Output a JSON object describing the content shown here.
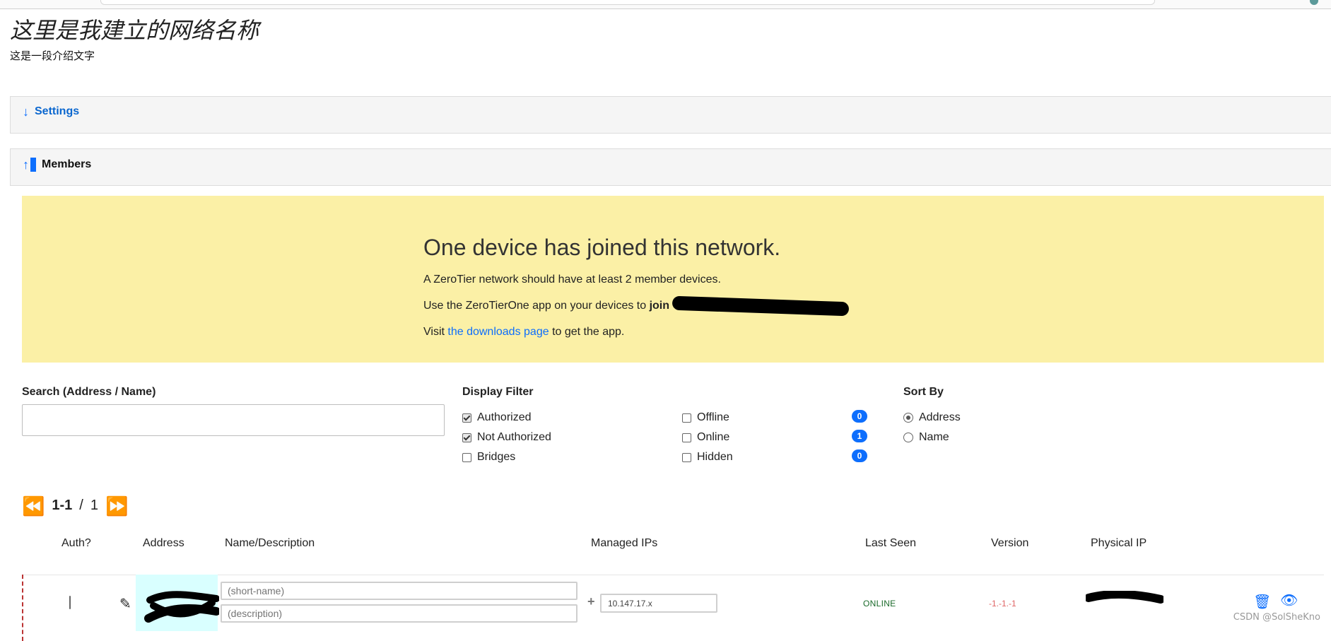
{
  "page": {
    "title": "这里是我建立的网络名称",
    "subtitle": "这是一段介绍文字"
  },
  "sections": {
    "settings": {
      "label": "Settings",
      "icon": "arrow-down-icon"
    },
    "members": {
      "label": "Members",
      "icon": "arrow-up-icon"
    }
  },
  "notice": {
    "headline": "One device has joined this network.",
    "line1": "A ZeroTier network should have at least 2 member devices.",
    "line2_prefix": "Use the ZeroTierOne app on your devices to ",
    "line2_bold": "join",
    "line3_prefix": "Visit ",
    "line3_link": "the downloads page",
    "line3_suffix": " to get the app."
  },
  "controls": {
    "search": {
      "label": "Search (Address / Name)",
      "placeholder": ""
    },
    "filter": {
      "label": "Display Filter",
      "options": {
        "authorized": {
          "label": "Authorized",
          "checked": true
        },
        "not_authorized": {
          "label": "Not Authorized",
          "checked": true
        },
        "bridges": {
          "label": "Bridges",
          "checked": false
        },
        "offline": {
          "label": "Offline",
          "checked": false,
          "count": "0"
        },
        "online": {
          "label": "Online",
          "checked": false,
          "count": "1"
        },
        "hidden": {
          "label": "Hidden",
          "checked": false,
          "count": "0"
        }
      }
    },
    "sort": {
      "label": "Sort By",
      "options": {
        "address": {
          "label": "Address",
          "checked": true
        },
        "name": {
          "label": "Name",
          "checked": false
        }
      }
    }
  },
  "pager": {
    "prev_icon": "rewind-icon",
    "next_icon": "fast-forward-icon",
    "range": "1-1",
    "separator": " / ",
    "total": "1"
  },
  "table": {
    "headers": {
      "auth": "Auth?",
      "address": "Address",
      "name_desc": "Name/Description",
      "managed_ips": "Managed IPs",
      "last_seen": "Last Seen",
      "version": "Version",
      "physical_ip": "Physical IP"
    },
    "row": {
      "short_name_placeholder": "(short-name)",
      "description_placeholder": "(description)",
      "managed_ip": "10.147.17.x",
      "last_seen": "ONLINE",
      "version": "-1.-1.-1",
      "icons": {
        "edit": "pencil-icon",
        "add_ip": "plus-icon",
        "delete": "trash-icon",
        "hide": "eye-slash-icon"
      }
    }
  },
  "watermark": "CSDN @SolSheKno",
  "colors": {
    "accent": "#0d6efd",
    "notice_bg": "#fbf0a6",
    "online_text": "#1b6b2b",
    "version_text": "#e06565"
  }
}
